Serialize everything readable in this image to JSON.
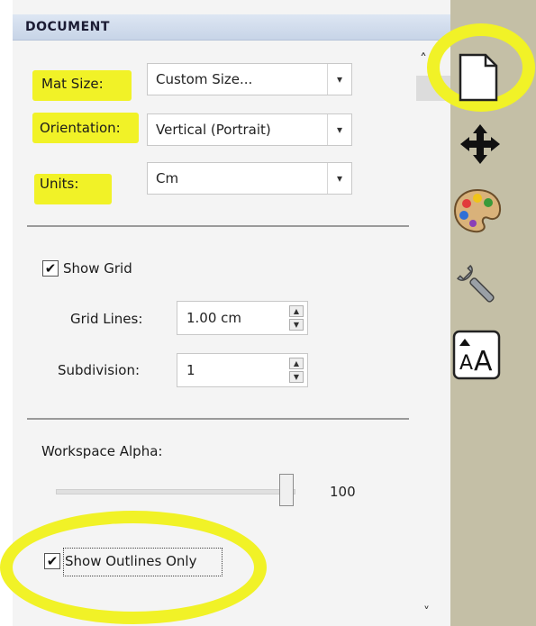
{
  "panel": {
    "title": "DOCUMENT"
  },
  "fields": {
    "mat_size": {
      "label": "Mat Size:",
      "value": "Custom Size..."
    },
    "orientation": {
      "label": "Orientation:",
      "value": "Vertical (Portrait)"
    },
    "units": {
      "label": "Units:",
      "value": "Cm"
    }
  },
  "grid": {
    "show_grid_label": "Show Grid",
    "show_grid_checked": true,
    "grid_lines_label": "Grid Lines:",
    "grid_lines_value": "1.00 cm",
    "subdivision_label": "Subdivision:",
    "subdivision_value": "1"
  },
  "workspace": {
    "alpha_label": "Workspace Alpha:",
    "alpha_value": "100",
    "alpha_fraction": 1.0
  },
  "outlines": {
    "label": "Show Outlines Only",
    "checked": true
  },
  "glyphs": {
    "dropdown": "▾",
    "spin_up": "▲",
    "spin_down": "▼",
    "scroll_up": "˄",
    "scroll_down": "˅",
    "check": "✔"
  },
  "rail_icons": [
    "document-icon",
    "move-icon",
    "palette-icon",
    "wrench-icon",
    "text-icon"
  ],
  "colors": {
    "highlight": "#f1f227",
    "header": "#c7d4e7",
    "rail": "#c4bfa6"
  }
}
